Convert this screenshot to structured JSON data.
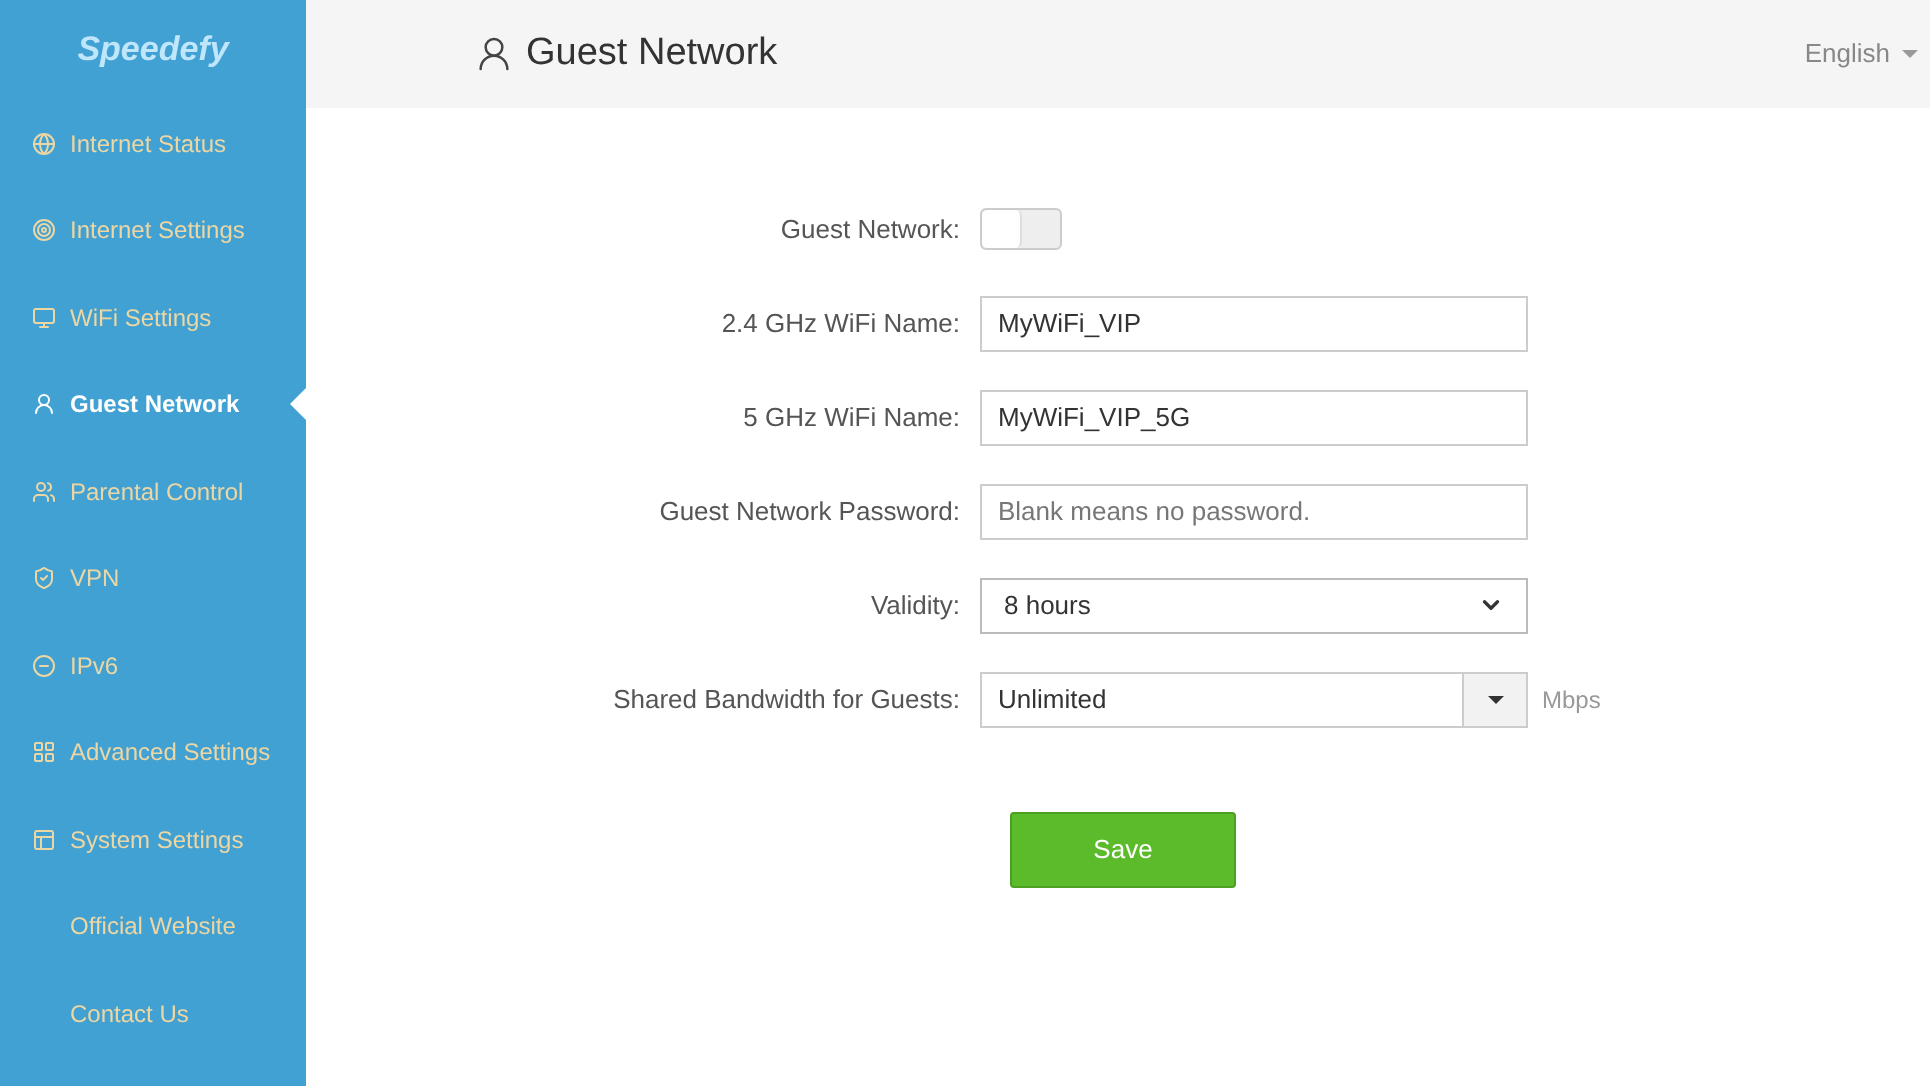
{
  "sidebar": {
    "logo": "Speedefy",
    "items": [
      {
        "label": "Internet Status",
        "selected": false
      },
      {
        "label": "Internet Settings",
        "selected": false
      },
      {
        "label": "WiFi Settings",
        "selected": false
      },
      {
        "label": "Guest Network",
        "selected": true
      },
      {
        "label": "Parental Control",
        "selected": false
      },
      {
        "label": "VPN",
        "selected": false
      },
      {
        "label": "IPv6",
        "selected": false
      },
      {
        "label": "Advanced Settings",
        "selected": false
      },
      {
        "label": "System Settings",
        "selected": false
      },
      {
        "label": "Official Website",
        "selected": false
      },
      {
        "label": "Contact Us",
        "selected": false
      }
    ]
  },
  "header": {
    "title": "Guest Network",
    "language": "English"
  },
  "form": {
    "rows": [
      {
        "kind": "toggle",
        "label": "Guest Network:",
        "on": false
      },
      {
        "kind": "text",
        "label": "2.4 GHz WiFi Name:",
        "value": "MyWiFi_VIP"
      },
      {
        "kind": "text",
        "label": "5 GHz WiFi Name:",
        "value": "MyWiFi_VIP_5G"
      },
      {
        "kind": "text",
        "label": "Guest Network Password:",
        "placeholder": "Blank means no password."
      },
      {
        "kind": "select",
        "label": "Validity:",
        "value": "8 hours"
      },
      {
        "kind": "combo",
        "label": "Shared Bandwidth for Guests:",
        "value": "Unlimited",
        "unit": "Mbps"
      }
    ],
    "save": "Save"
  }
}
